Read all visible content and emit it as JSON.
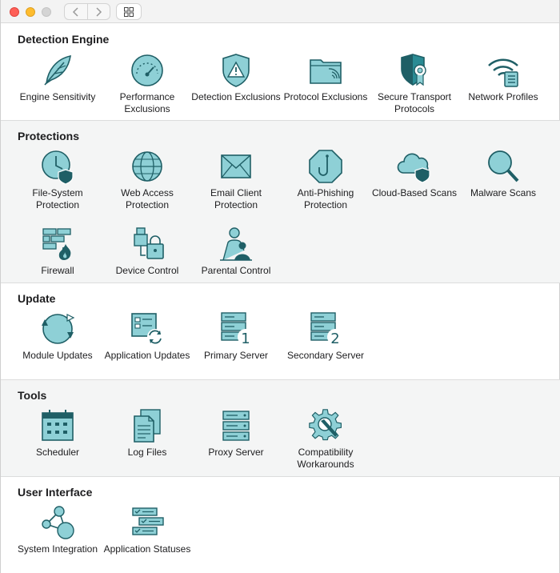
{
  "window": {
    "colors": {
      "icon_fill": "#8ed0d6",
      "icon_stroke": "#1f5f66",
      "accent": "#2a8b94"
    }
  },
  "sections": [
    {
      "title": "Detection Engine",
      "items": [
        {
          "label": "Engine Sensitivity",
          "icon": "feather-icon"
        },
        {
          "label": "Performance Exclusions",
          "icon": "gauge-icon"
        },
        {
          "label": "Detection Exclusions",
          "icon": "warning-shield-icon"
        },
        {
          "label": "Protocol Exclusions",
          "icon": "folder-wifi-icon"
        },
        {
          "label": "Secure Transport Protocols",
          "icon": "shield-certificate-icon"
        },
        {
          "label": "Network Profiles",
          "icon": "wifi-list-icon"
        }
      ]
    },
    {
      "title": "Protections",
      "items": [
        {
          "label": "File-System Protection",
          "icon": "clock-shield-icon"
        },
        {
          "label": "Web Access Protection",
          "icon": "globe-icon"
        },
        {
          "label": "Email Client Protection",
          "icon": "envelope-icon"
        },
        {
          "label": "Anti-Phishing Protection",
          "icon": "hook-octagon-icon"
        },
        {
          "label": "Cloud-Based Scans",
          "icon": "cloud-shield-icon"
        },
        {
          "label": "Malware Scans",
          "icon": "magnifier-icon"
        },
        {
          "label": "Firewall",
          "icon": "firewall-icon"
        },
        {
          "label": "Device Control",
          "icon": "usb-lock-icon"
        },
        {
          "label": "Parental Control",
          "icon": "parental-icon"
        }
      ]
    },
    {
      "title": "Update",
      "items": [
        {
          "label": "Module Updates",
          "icon": "refresh-circle-icon"
        },
        {
          "label": "Application Updates",
          "icon": "app-refresh-icon"
        },
        {
          "label": "Primary Server",
          "icon": "server-1-icon"
        },
        {
          "label": "Secondary Server",
          "icon": "server-2-icon"
        }
      ]
    },
    {
      "title": "Tools",
      "items": [
        {
          "label": "Scheduler",
          "icon": "calendar-icon"
        },
        {
          "label": "Log Files",
          "icon": "documents-icon"
        },
        {
          "label": "Proxy Server",
          "icon": "server-icon"
        },
        {
          "label": "Compatibility Workarounds",
          "icon": "gear-wrench-icon"
        }
      ]
    },
    {
      "title": "User Interface",
      "items": [
        {
          "label": "System Integration",
          "icon": "nodes-icon"
        },
        {
          "label": "Application Statuses",
          "icon": "status-list-icon"
        }
      ]
    }
  ]
}
